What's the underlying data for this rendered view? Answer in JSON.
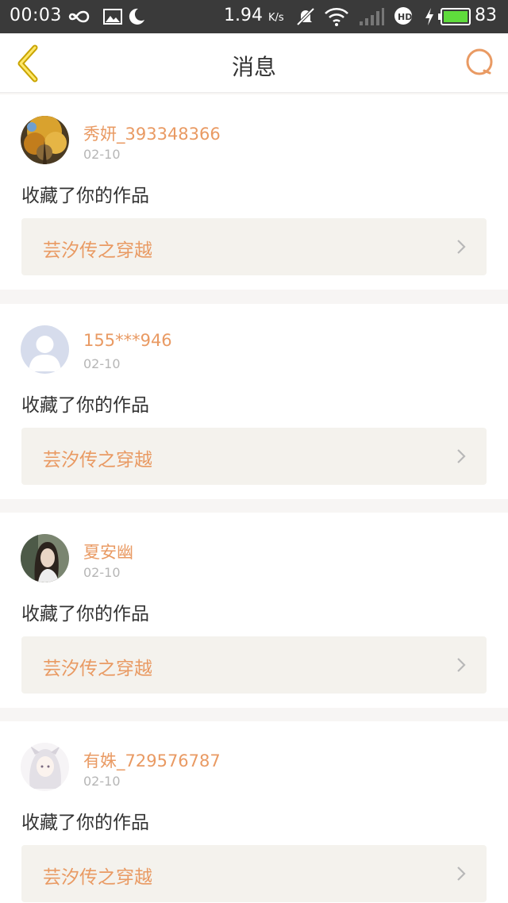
{
  "status_bar": {
    "time": "00:03",
    "speed_value": "1.94",
    "speed_unit": "K/s",
    "battery": "83",
    "icons": [
      "infinity-icon",
      "image-icon",
      "moon-icon",
      "mute-icon",
      "wifi-icon",
      "signal-icon",
      "hd-icon",
      "charging-icon",
      "battery-icon"
    ]
  },
  "header": {
    "title": "消息",
    "back_icon": "chevron-left-icon",
    "search_icon": "search-icon"
  },
  "colors": {
    "accent": "#e99a63",
    "background": "#f7f5f4",
    "link_bg": "#f4f2ed"
  },
  "messages": [
    {
      "username": "秀妍_393348366",
      "date": "02-10",
      "action": "收藏了你的作品",
      "work_title": "芸汐传之穿越",
      "avatar": "autumn-tree-avatar"
    },
    {
      "username": "155***946",
      "date": "02-10",
      "action": "收藏了你的作品",
      "work_title": "芸汐传之穿越",
      "avatar": "default-avatar"
    },
    {
      "username": "夏安幽",
      "date": "02-10",
      "action": "收藏了你的作品",
      "work_title": "芸汐传之穿越",
      "avatar": "girl-photo-avatar"
    },
    {
      "username": "有姝_729576787",
      "date": "02-10",
      "action": "收藏了你的作品",
      "work_title": "芸汐传之穿越",
      "avatar": "anime-girl-avatar"
    }
  ]
}
